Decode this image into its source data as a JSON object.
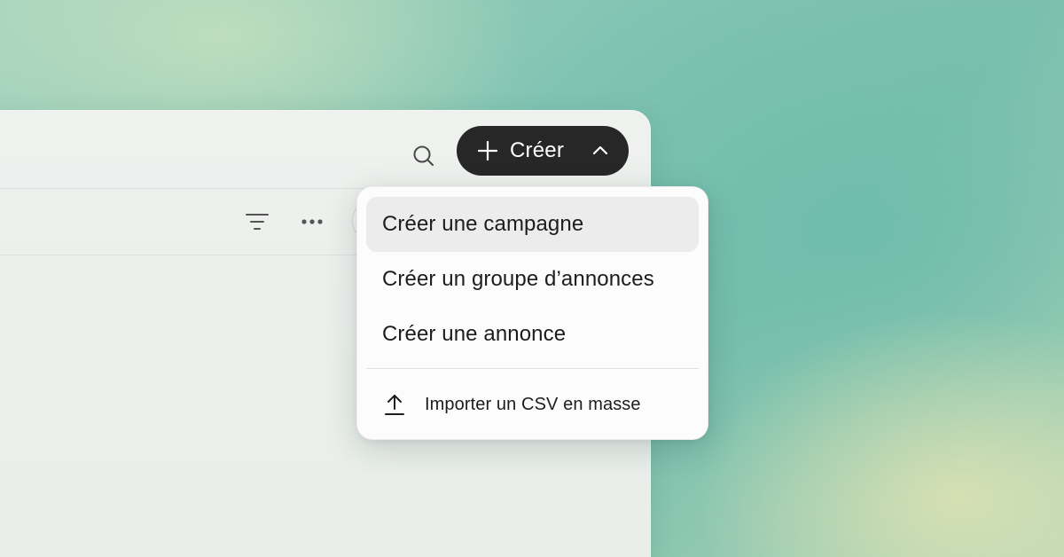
{
  "header": {
    "search_icon": "search-icon",
    "create_button": {
      "label": "Créer",
      "icon_left": "plus-icon",
      "icon_right": "chevron-up-icon",
      "background": "#272727",
      "text_color": "#ffffff"
    }
  },
  "toolbar": {
    "filter_icon": "filter-icon",
    "more_icon": "more-horizontal-icon"
  },
  "create_menu": {
    "items": [
      {
        "label": "Créer une campagne",
        "state": "highlighted"
      },
      {
        "label": "Créer un groupe d’annonces"
      },
      {
        "label": "Créer une annonce"
      }
    ],
    "import_item": {
      "label": "Importer un CSV en masse",
      "icon": "upload-icon"
    }
  },
  "colors": {
    "highlight": "#ececec",
    "menu_background": "#fcfcfc",
    "text": "#1d1d1d"
  }
}
